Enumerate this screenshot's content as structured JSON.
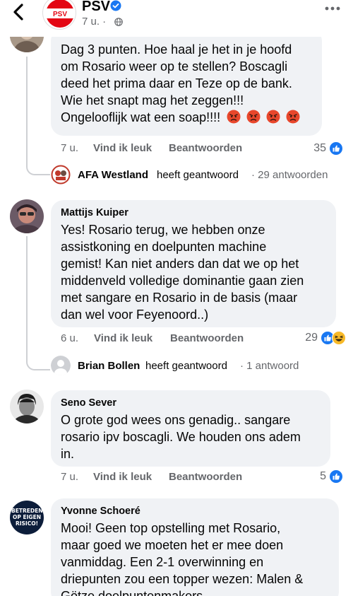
{
  "header": {
    "page_name": "PSV",
    "post_time": "7 u. ·",
    "back_icon": "chevron-left-icon",
    "verified_icon": "verified-badge-icon",
    "audience_icon": "globe-icon",
    "more_icon": "more-dots-icon",
    "accent": "#1877f2"
  },
  "comments": [
    {
      "author": "",
      "lines": [
        "Dag 3 punten. Hoe haal je het in je hoofd",
        "om Rosario weer op te stellen? Boscagli",
        "deed het prima daar en Teze op de bank.",
        "Wie het snapt mag het zeggen!!!",
        "Ongelooflijk wat een soap!!!!"
      ],
      "emojis": [
        "angry",
        "angry",
        "angry",
        "angry"
      ],
      "time": "7 u.",
      "like_label": "Vind ik leuk",
      "reply_label": "Beantwoorden",
      "reaction_count": "35",
      "reaction_icons": [
        "like-icon"
      ],
      "reply_summary": {
        "name": "AFA Westland",
        "action": "heeft geantwoord",
        "count": "· 29 antwoorden"
      }
    },
    {
      "author": "Mattijs Kuiper",
      "lines": [
        "Yes! Rosario terug, we hebben onze",
        "assistkoning en doelpunten machine",
        "gemist! Kan niet anders dan dat we op het",
        "middenveld volledige dominantie gaan zien",
        "met sangare en Rosario in de basis (maar",
        "dan wel voor Feyenoord..)"
      ],
      "time": "6 u.",
      "like_label": "Vind ik leuk",
      "reply_label": "Beantwoorden",
      "reaction_count": "29",
      "reaction_icons": [
        "like-icon",
        "haha-icon"
      ],
      "reply_summary": {
        "name": "Brian Bollen",
        "action": "heeft geantwoord",
        "count": "· 1 antwoord"
      }
    },
    {
      "author": "Seno Sever",
      "lines": [
        "O grote god wees ons genadig.. sangare",
        "rosario ipv boscagli. We houden ons adem",
        "in."
      ],
      "time": "7 u.",
      "like_label": "Vind ik leuk",
      "reply_label": "Beantwoorden",
      "reaction_count": "5",
      "reaction_icons": [
        "like-icon"
      ]
    },
    {
      "author": "Yvonne Schoeré",
      "avatar_text": "BETREDEN OP EIGEN RISICO!",
      "lines": [
        "Mooi! Geen top opstelling met Rosario,",
        "maar goed we moeten het er mee doen",
        "vanmiddag. Een 2-1 overwinning en",
        "driepunten zou een topper wezen: Malen &",
        "Götze doelpuntenmakers."
      ]
    }
  ]
}
